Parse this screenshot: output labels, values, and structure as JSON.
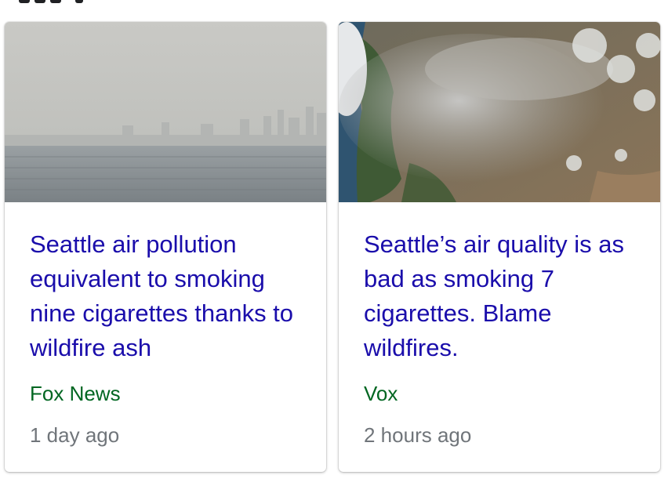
{
  "cards": [
    {
      "headline": "Seattle air pollution equivalent to smoking nine cigarettes thanks to wildfire ash",
      "source": "Fox News",
      "time": "1 day ago",
      "image": "hazy-seattle-waterfront-skyline"
    },
    {
      "headline": "Seattle’s air quality is as bad as smoking 7 cigarettes. Blame wildfires.",
      "source": "Vox",
      "time": "2 hours ago",
      "image": "satellite-wildfire-smoke-pacific-northwest"
    }
  ],
  "colors": {
    "headline": "#1a0dab",
    "source": "#006621",
    "time": "#70757a"
  }
}
